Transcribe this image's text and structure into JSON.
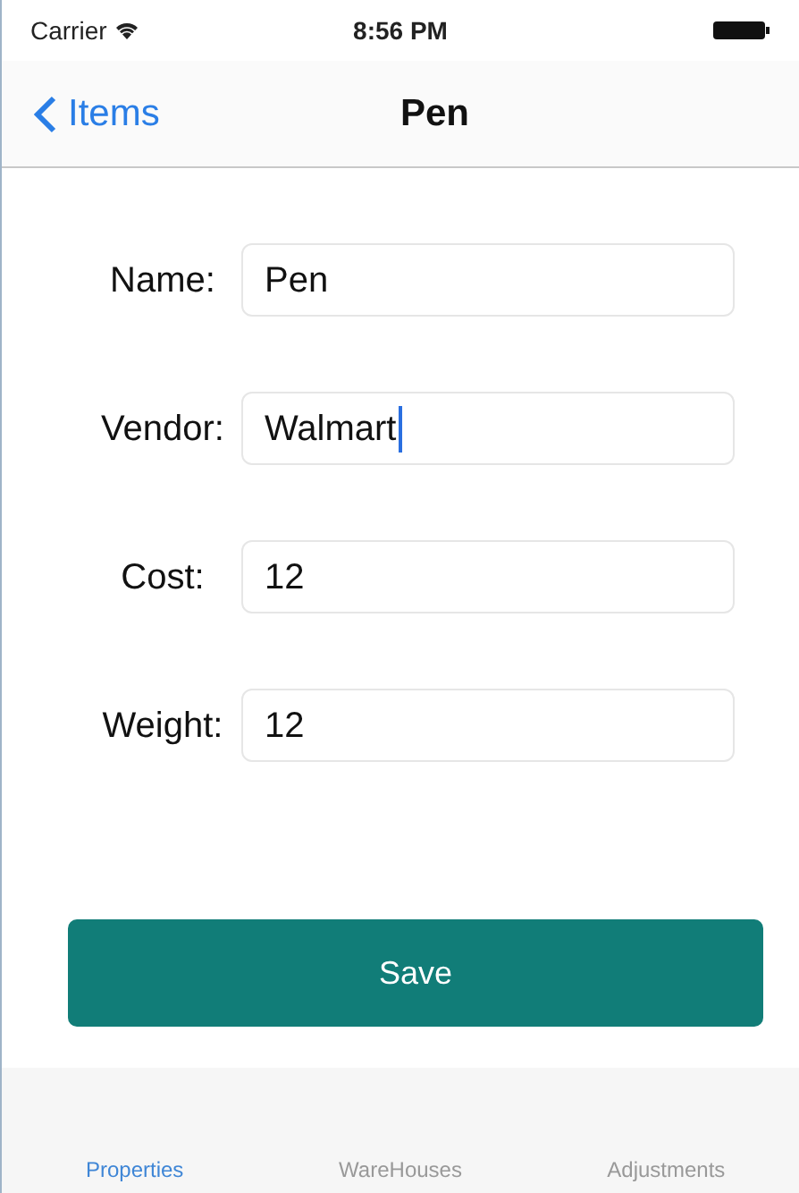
{
  "status_bar": {
    "carrier": "Carrier",
    "time": "8:56 PM"
  },
  "nav": {
    "back": "Items",
    "title": "Pen"
  },
  "fields": [
    {
      "label": "Name:",
      "value": "Pen",
      "focused": false
    },
    {
      "label": "Vendor:",
      "value": "Walmart",
      "focused": true
    },
    {
      "label": "Cost:",
      "value": "12",
      "focused": false
    },
    {
      "label": "Weight:",
      "value": "12",
      "focused": false
    }
  ],
  "save_button": "Save",
  "tabs": [
    {
      "label": "Properties",
      "selected": true
    },
    {
      "label": "WareHouses",
      "selected": false
    },
    {
      "label": "Adjustments",
      "selected": false
    }
  ]
}
